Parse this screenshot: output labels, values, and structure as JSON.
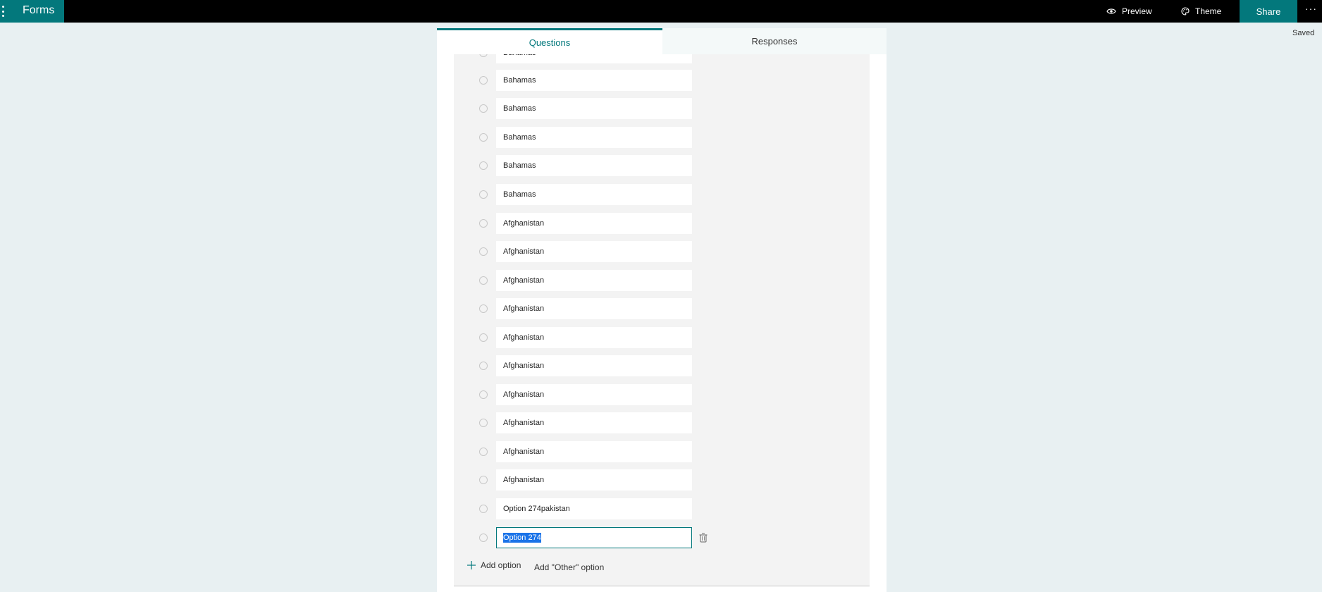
{
  "header": {
    "app_name": "Forms",
    "preview_label": "Preview",
    "theme_label": "Theme",
    "share_label": "Share",
    "more_label": "···",
    "saved_status": "Saved"
  },
  "tabs": {
    "questions": "Questions",
    "responses": "Responses"
  },
  "options": [
    "Bahamas",
    "Bahamas",
    "Bahamas",
    "Bahamas",
    "Bahamas",
    "Bahamas",
    "Afghanistan",
    "Afghanistan",
    "Afghanistan",
    "Afghanistan",
    "Afghanistan",
    "Afghanistan",
    "Afghanistan",
    "Afghanistan",
    "Afghanistan",
    "Afghanistan",
    "Option 274pakistan",
    "Option 274"
  ],
  "actions": {
    "add_option": "Add option",
    "add_other_option": "Add \"Other\" option"
  },
  "colors": {
    "accent": "#03787c",
    "page_bg": "#e8f0f2",
    "topbar_bg": "#000000",
    "selection": "#1a73e8"
  }
}
